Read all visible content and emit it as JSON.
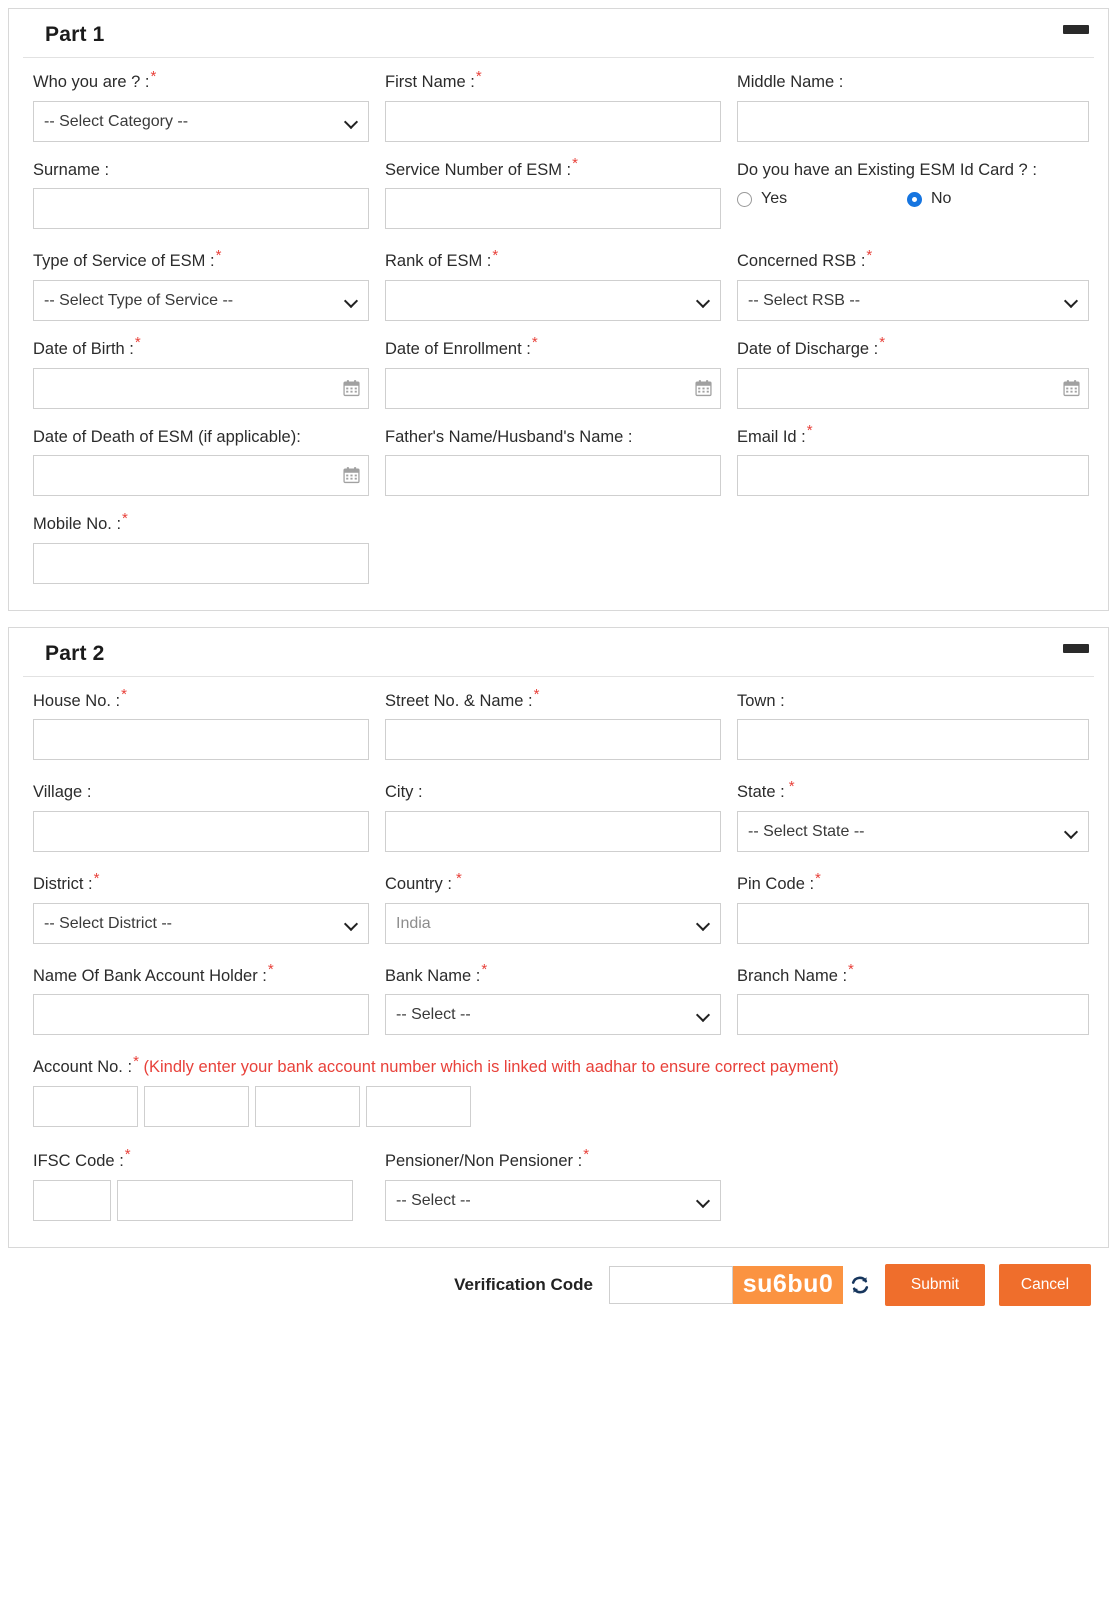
{
  "colors": {
    "required_star": "#e8413a",
    "captcha_bg": "#fb9341",
    "button_bg": "#ef6e2c",
    "radio_selected": "#1675e0",
    "note_red": "#e8413a"
  },
  "part1": {
    "title": "Part 1",
    "collapse_icon": "minus-icon",
    "fields": {
      "who_you_are": {
        "label": "Who you are ? :",
        "required": true,
        "type": "select",
        "value": "-- Select Category --"
      },
      "first_name": {
        "label": "First Name :",
        "required": true,
        "type": "text",
        "value": ""
      },
      "middle_name": {
        "label": "Middle Name :",
        "required": false,
        "type": "text",
        "value": ""
      },
      "surname": {
        "label": "Surname :",
        "required": false,
        "type": "text",
        "value": ""
      },
      "service_number": {
        "label": "Service Number of ESM :",
        "required": true,
        "type": "text",
        "value": ""
      },
      "existing_esm_card": {
        "label": "Do you have an Existing ESM Id Card ? :",
        "required": false,
        "type": "radio",
        "options": [
          "Yes",
          "No"
        ],
        "selected": "No"
      },
      "type_of_service": {
        "label": "Type of Service of ESM :",
        "required": true,
        "type": "select",
        "value": "-- Select Type of Service --"
      },
      "rank_of_esm": {
        "label": "Rank of ESM :",
        "required": true,
        "type": "select",
        "value": ""
      },
      "concerned_rsb": {
        "label": "Concerned RSB :",
        "required": true,
        "type": "select",
        "value": "-- Select RSB --"
      },
      "date_of_birth": {
        "label": "Date of Birth :",
        "required": true,
        "type": "date",
        "value": ""
      },
      "date_of_enrollment": {
        "label": "Date of Enrollment :",
        "required": true,
        "type": "date",
        "value": ""
      },
      "date_of_discharge": {
        "label": "Date of Discharge :",
        "required": true,
        "type": "date",
        "value": ""
      },
      "date_of_death": {
        "label": "Date of Death of ESM (if applicable):",
        "required": false,
        "type": "date",
        "value": ""
      },
      "father_husband_name": {
        "label": "Father's Name/Husband's Name :",
        "required": false,
        "type": "text",
        "value": ""
      },
      "email_id": {
        "label": "Email Id :",
        "required": true,
        "type": "text",
        "value": ""
      },
      "mobile_no": {
        "label": "Mobile No. :",
        "required": true,
        "type": "text",
        "value": ""
      }
    }
  },
  "part2": {
    "title": "Part 2",
    "collapse_icon": "minus-icon",
    "fields": {
      "house_no": {
        "label": "House No. :",
        "required": true,
        "type": "text",
        "value": ""
      },
      "street_no_name": {
        "label": "Street No. & Name :",
        "required": true,
        "type": "text",
        "value": ""
      },
      "town": {
        "label": "Town :",
        "required": false,
        "type": "text",
        "value": ""
      },
      "village": {
        "label": "Village :",
        "required": false,
        "type": "text",
        "value": ""
      },
      "city": {
        "label": "City :",
        "required": false,
        "type": "text",
        "value": ""
      },
      "state": {
        "label": "State :",
        "required": true,
        "type": "select",
        "value": "-- Select State --"
      },
      "district": {
        "label": "District :",
        "required": true,
        "type": "select",
        "value": "-- Select District --"
      },
      "country": {
        "label": "Country :",
        "required": true,
        "type": "select",
        "value": "India",
        "disabled": true
      },
      "pin_code": {
        "label": "Pin Code :",
        "required": true,
        "type": "text",
        "value": ""
      },
      "bank_account_holder": {
        "label": "Name Of Bank Account Holder :",
        "required": true,
        "type": "text",
        "value": ""
      },
      "bank_name": {
        "label": "Bank Name :",
        "required": true,
        "type": "select",
        "value": "-- Select --"
      },
      "branch_name": {
        "label": "Branch Name :",
        "required": true,
        "type": "text",
        "value": ""
      },
      "account_no": {
        "label": "Account No. :",
        "required": true,
        "note": "(Kindly enter your bank account number which is linked with aadhar to ensure correct payment)",
        "type": "segmented-text",
        "segments": [
          "",
          "",
          "",
          ""
        ]
      },
      "ifsc_code": {
        "label": "IFSC Code :",
        "required": true,
        "type": "segmented-text",
        "segments": [
          "",
          ""
        ]
      },
      "pensioner": {
        "label": "Pensioner/Non Pensioner :",
        "required": true,
        "type": "select",
        "value": "-- Select --"
      }
    }
  },
  "footer": {
    "verification_label": "Verification Code",
    "verification_value": "",
    "captcha_text": "su6bu0",
    "refresh_icon": "refresh-icon",
    "submit_label": "Submit",
    "cancel_label": "Cancel"
  }
}
